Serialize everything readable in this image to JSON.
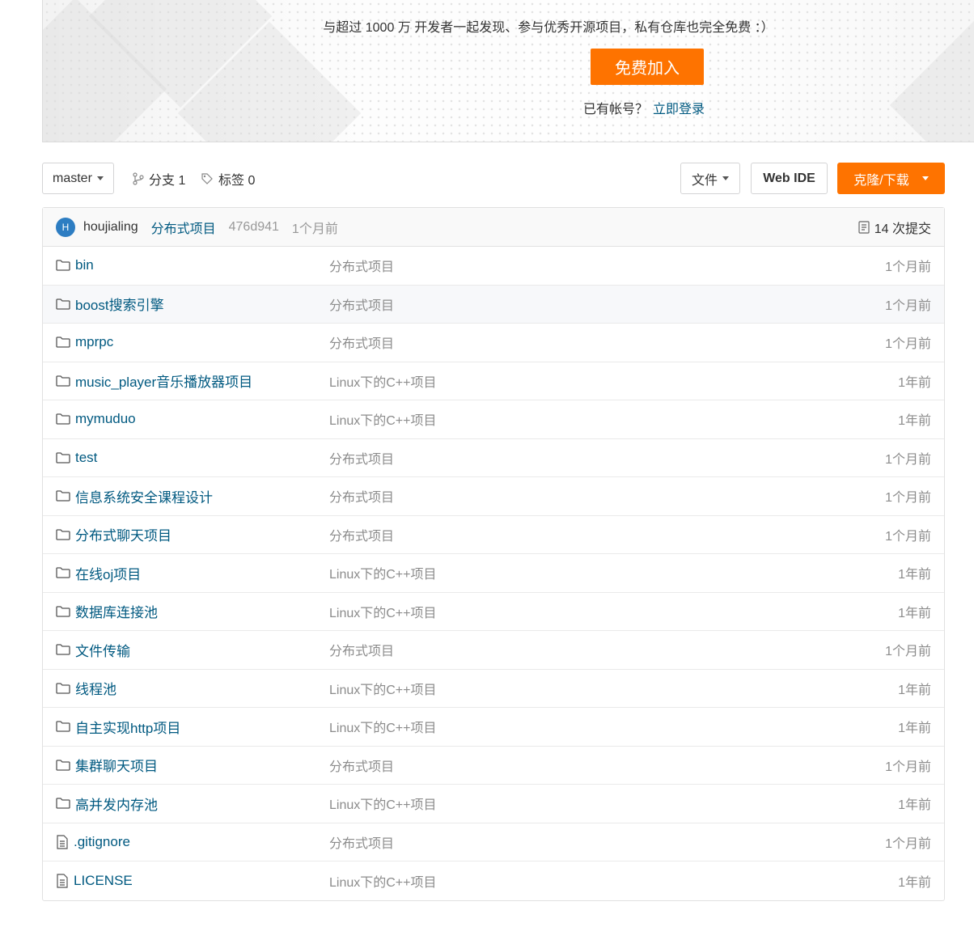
{
  "banner": {
    "tagline": "与超过 1000 万 开发者一起发现、参与优秀开源项目，私有仓库也完全免费 ：）",
    "join_label": "免费加入",
    "have_account": "已有帐号？",
    "login_label": "立即登录"
  },
  "toolbar": {
    "branch": "master",
    "branches_label": "分支 1",
    "tags_label": "标签 0",
    "file_label": "文件",
    "webide_label": "Web IDE",
    "clone_label": "克隆/下载"
  },
  "commit": {
    "avatar_letter": "H",
    "author": "houjialing",
    "message": "分布式项目",
    "sha": "476d941",
    "time": "1个月前",
    "count_label": "14 次提交"
  },
  "files": [
    {
      "name": "bin",
      "message": "分布式项目",
      "time": "1个月前",
      "icon": "folder-icon"
    },
    {
      "name": "boost搜索引擎",
      "message": "分布式项目",
      "time": "1个月前",
      "icon": "folder-icon"
    },
    {
      "name": "mprpc",
      "message": "分布式项目",
      "time": "1个月前",
      "icon": "folder-icon"
    },
    {
      "name": "music_player音乐播放器项目",
      "message": "Linux下的C++项目",
      "time": "1年前",
      "icon": "folder-icon"
    },
    {
      "name": "mymuduo",
      "message": "Linux下的C++项目",
      "time": "1年前",
      "icon": "folder-icon"
    },
    {
      "name": "test",
      "message": "分布式项目",
      "time": "1个月前",
      "icon": "folder-icon"
    },
    {
      "name": "信息系统安全课程设计",
      "message": "分布式项目",
      "time": "1个月前",
      "icon": "folder-icon"
    },
    {
      "name": "分布式聊天项目",
      "message": "分布式项目",
      "time": "1个月前",
      "icon": "folder-icon"
    },
    {
      "name": "在线oj项目",
      "message": "Linux下的C++项目",
      "time": "1年前",
      "icon": "folder-icon"
    },
    {
      "name": "数据库连接池",
      "message": "Linux下的C++项目",
      "time": "1年前",
      "icon": "folder-icon"
    },
    {
      "name": "文件传输",
      "message": "分布式项目",
      "time": "1个月前",
      "icon": "folder-icon"
    },
    {
      "name": "线程池",
      "message": "Linux下的C++项目",
      "time": "1年前",
      "icon": "folder-icon"
    },
    {
      "name": "自主实现http项目",
      "message": "Linux下的C++项目",
      "time": "1年前",
      "icon": "folder-icon"
    },
    {
      "name": "集群聊天项目",
      "message": "分布式项目",
      "time": "1个月前",
      "icon": "folder-icon"
    },
    {
      "name": "高并发内存池",
      "message": "Linux下的C++项目",
      "time": "1年前",
      "icon": "folder-icon"
    },
    {
      "name": ".gitignore",
      "message": "分布式项目",
      "time": "1个月前",
      "icon": "file-icon"
    },
    {
      "name": "LICENSE",
      "message": "Linux下的C++项目",
      "time": "1年前",
      "icon": "file-icon"
    }
  ],
  "colors": {
    "accent": "#fe7300",
    "link": "#005980",
    "muted": "#8c8c8c"
  }
}
